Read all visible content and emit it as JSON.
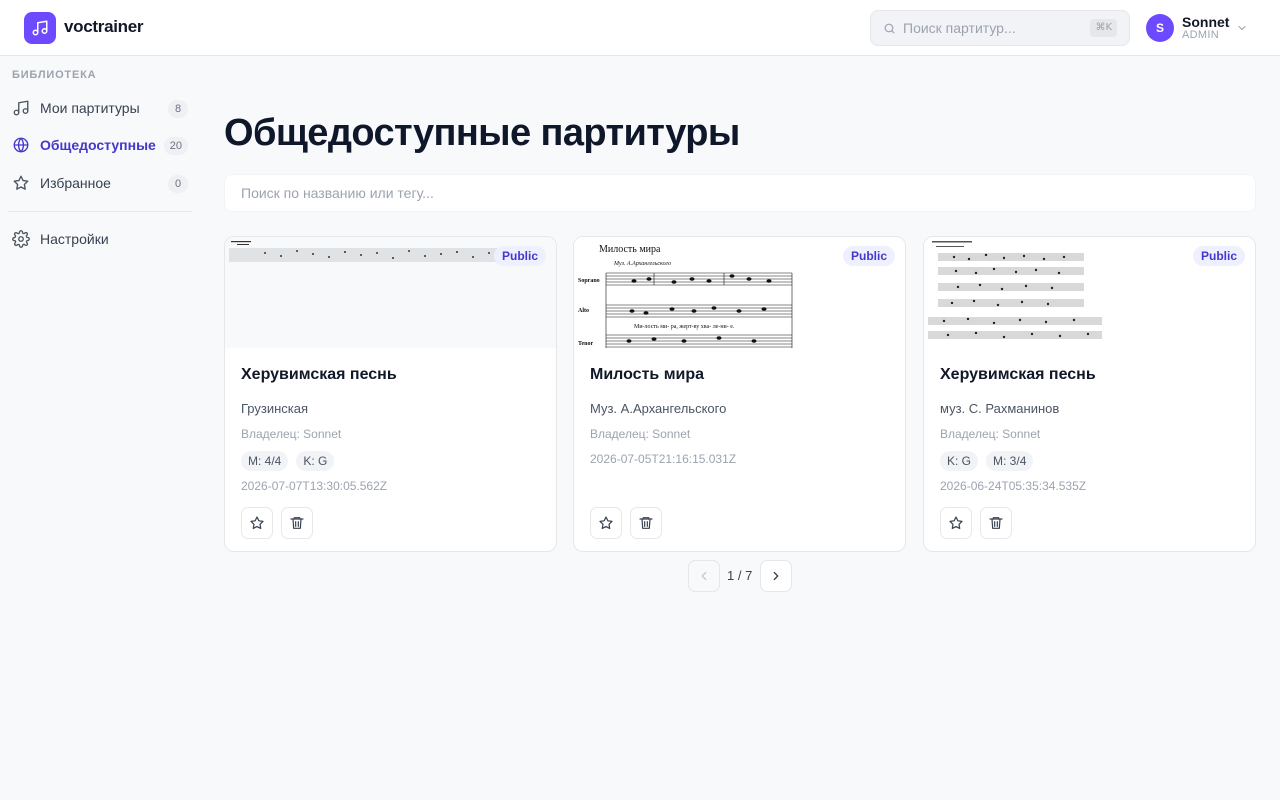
{
  "app": {
    "name": "voctrainer",
    "logo_icon": "music-note-icon",
    "accent_color": "#6d4aff"
  },
  "header": {
    "search_placeholder": "Поиск партитур...",
    "search_shortcut": "⌘K",
    "user": {
      "initial": "S",
      "name": "Sonnet",
      "role": "ADMIN"
    }
  },
  "sidebar": {
    "section_title": "БИБЛИОТЕКА",
    "items": [
      {
        "label": "Мои партитуры",
        "count": "8",
        "icon": "music-note-icon",
        "active": false
      },
      {
        "label": "Общедоступные",
        "count": "20",
        "icon": "globe-icon",
        "active": true
      },
      {
        "label": "Избранное",
        "count": "0",
        "icon": "star-icon",
        "active": false
      }
    ],
    "settings_label": "Настройки"
  },
  "main": {
    "title": "Общедоступные партитуры",
    "search_placeholder": "Поиск по названию или тегу...",
    "cards": [
      {
        "badge": "Public",
        "title": "Херувимская песнь",
        "composer": "Грузинская",
        "owner": "Владелец: Sonnet",
        "tags": [
          "M: 4/4",
          "K: G"
        ],
        "date": "2026-07-07T13:30:05.562Z"
      },
      {
        "badge": "Public",
        "title": "Милость мира",
        "composer": "Муз. А.Архангельского",
        "owner": "Владелец: Sonnet",
        "tags": [],
        "date": "2026-07-05T21:16:15.031Z",
        "thumb": {
          "heading": "Милость мира",
          "subheading": "Муз. А.Архангельского",
          "voices": [
            "Soprano",
            "Alto",
            "Tenor"
          ],
          "lyrics": "Ми-лость ми-    ра,    жерт-ву хва-    ле-ни-    е."
        }
      },
      {
        "badge": "Public",
        "title": "Херувимская песнь",
        "composer": "муз. С. Рахманинов",
        "owner": "Владелец: Sonnet",
        "tags": [
          "K: G",
          "M: 3/4"
        ],
        "date": "2026-06-24T05:35:34.535Z"
      }
    ]
  },
  "pagination": {
    "text": "1 / 7"
  }
}
